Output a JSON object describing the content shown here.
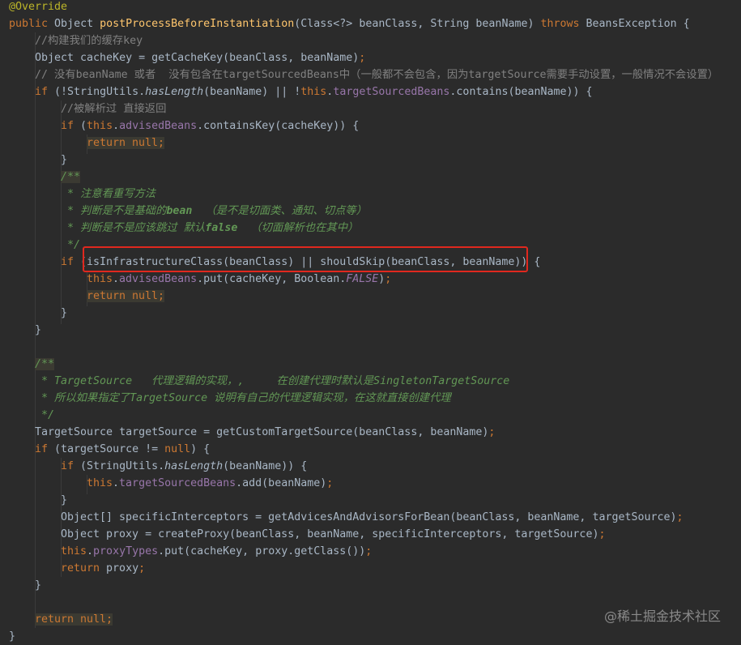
{
  "lines": [
    {
      "indent": 0,
      "tokens": [
        [
          "ann",
          "@Override"
        ]
      ]
    },
    {
      "indent": 0,
      "tokens": [
        [
          "kw",
          "public "
        ],
        [
          "t",
          "Object "
        ],
        [
          "fn",
          "postProcessBeforeInstantiation"
        ],
        [
          "t",
          "(Class<?> beanClass, String beanName) "
        ],
        [
          "kw",
          "throws "
        ],
        [
          "t",
          "BeansException {"
        ]
      ]
    },
    {
      "indent": 1,
      "tokens": [
        [
          "cm",
          "//构建我们的缓存key"
        ]
      ]
    },
    {
      "indent": 1,
      "tokens": [
        [
          "t",
          "Object cacheKey = getCacheKey(beanClass, beanName)"
        ],
        [
          "kw",
          ";"
        ]
      ]
    },
    {
      "indent": 1,
      "tokens": [
        [
          "cm",
          "// 没有beanName 或者  没有包含在targetSourcedBeans中（一般都不会包含，因为targetSource需要手动设置，一般情况不会设置）"
        ]
      ]
    },
    {
      "indent": 1,
      "tokens": [
        [
          "kw",
          "if "
        ],
        [
          "t",
          "(!StringUtils."
        ],
        [
          "itc",
          "hasLength"
        ],
        [
          "t",
          "(beanName) || !"
        ],
        [
          "kw",
          "this"
        ],
        [
          "t",
          "."
        ],
        [
          "fld",
          "targetSourcedBeans"
        ],
        [
          "t",
          ".contains(beanName)) {"
        ]
      ]
    },
    {
      "indent": 2,
      "tokens": [
        [
          "cm",
          "//被解析过 直接返回"
        ]
      ]
    },
    {
      "indent": 2,
      "tokens": [
        [
          "kw",
          "if "
        ],
        [
          "t",
          "("
        ],
        [
          "kw",
          "this"
        ],
        [
          "t",
          "."
        ],
        [
          "fld",
          "advisedBeans"
        ],
        [
          "t",
          ".containsKey(cacheKey)) {"
        ]
      ]
    },
    {
      "indent": 3,
      "tokens": [
        [
          "kwhl",
          "return null;"
        ]
      ]
    },
    {
      "indent": 2,
      "tokens": [
        [
          "t",
          "}"
        ]
      ]
    },
    {
      "indent": 2,
      "tokens": [
        [
          "dochl",
          "/**"
        ]
      ]
    },
    {
      "indent": 2,
      "tokens": [
        [
          "doc",
          " * 注意看重写方法"
        ]
      ]
    },
    {
      "indent": 2,
      "tokens": [
        [
          "doc",
          " * 判断是不是基础的"
        ],
        [
          "dtag",
          "bean"
        ],
        [
          "doc",
          "  （是不是切面类、通知、切点等）"
        ]
      ]
    },
    {
      "indent": 2,
      "tokens": [
        [
          "doc",
          " * 判断是不是应该跳过 默认"
        ],
        [
          "dtag",
          "false"
        ],
        [
          "doc",
          "  （切面解析也在其中）"
        ]
      ]
    },
    {
      "indent": 2,
      "tokens": [
        [
          "doc",
          " */"
        ]
      ]
    },
    {
      "indent": 2,
      "tokens": [
        [
          "kw",
          "if "
        ],
        [
          "t",
          "(isInfrastructureClass(beanClass) || shouldSkip(beanClass, beanName)) {"
        ]
      ]
    },
    {
      "indent": 3,
      "tokens": [
        [
          "kw",
          "this"
        ],
        [
          "t",
          "."
        ],
        [
          "fld",
          "advisedBeans"
        ],
        [
          "t",
          ".put(cacheKey, Boolean."
        ],
        [
          "fldi",
          "FALSE"
        ],
        [
          "t",
          ")"
        ],
        [
          "kw",
          ";"
        ]
      ]
    },
    {
      "indent": 3,
      "tokens": [
        [
          "kwhl",
          "return null;"
        ]
      ]
    },
    {
      "indent": 2,
      "tokens": [
        [
          "t",
          "}"
        ]
      ]
    },
    {
      "indent": 1,
      "tokens": [
        [
          "t",
          "}"
        ]
      ]
    },
    {
      "indent": 0,
      "tokens": []
    },
    {
      "indent": 1,
      "tokens": [
        [
          "dochl",
          "/**"
        ]
      ]
    },
    {
      "indent": 1,
      "tokens": [
        [
          "doc",
          " * TargetSource   代理逻辑的实现，,     在创建代理时默认是SingletonTargetSource"
        ]
      ]
    },
    {
      "indent": 1,
      "tokens": [
        [
          "doc",
          " * 所以如果指定了TargetSource 说明有自己的代理逻辑实现，在这就直接创建代理"
        ]
      ]
    },
    {
      "indent": 1,
      "tokens": [
        [
          "doc",
          " */"
        ]
      ]
    },
    {
      "indent": 1,
      "tokens": [
        [
          "t",
          "TargetSource targetSource = getCustomTargetSource(beanClass, beanName)"
        ],
        [
          "kw",
          ";"
        ]
      ]
    },
    {
      "indent": 1,
      "tokens": [
        [
          "kw",
          "if "
        ],
        [
          "t",
          "(targetSource != "
        ],
        [
          "kw",
          "null"
        ],
        [
          "t",
          ") {"
        ]
      ]
    },
    {
      "indent": 2,
      "tokens": [
        [
          "kw",
          "if "
        ],
        [
          "t",
          "(StringUtils."
        ],
        [
          "itc",
          "hasLength"
        ],
        [
          "t",
          "(beanName)) {"
        ]
      ]
    },
    {
      "indent": 3,
      "tokens": [
        [
          "kw",
          "this"
        ],
        [
          "t",
          "."
        ],
        [
          "fld",
          "targetSourcedBeans"
        ],
        [
          "t",
          ".add(beanName)"
        ],
        [
          "kw",
          ";"
        ]
      ]
    },
    {
      "indent": 2,
      "tokens": [
        [
          "t",
          "}"
        ]
      ]
    },
    {
      "indent": 2,
      "tokens": [
        [
          "t",
          "Object[] specificInterceptors = getAdvicesAndAdvisorsForBean(beanClass, beanName, targetSource)"
        ],
        [
          "kw",
          ";"
        ]
      ]
    },
    {
      "indent": 2,
      "tokens": [
        [
          "t",
          "Object proxy = createProxy(beanClass, beanName, specificInterceptors, targetSource)"
        ],
        [
          "kw",
          ";"
        ]
      ]
    },
    {
      "indent": 2,
      "tokens": [
        [
          "kw",
          "this"
        ],
        [
          "t",
          "."
        ],
        [
          "fld",
          "proxyTypes"
        ],
        [
          "t",
          ".put(cacheKey, proxy.getClass())"
        ],
        [
          "kw",
          ";"
        ]
      ]
    },
    {
      "indent": 2,
      "tokens": [
        [
          "kw",
          "return "
        ],
        [
          "t",
          "proxy"
        ],
        [
          "kw",
          ";"
        ]
      ]
    },
    {
      "indent": 1,
      "tokens": [
        [
          "t",
          "}"
        ]
      ]
    },
    {
      "indent": 0,
      "tokens": []
    },
    {
      "indent": 1,
      "tokens": [
        [
          "kwhl",
          "return null;"
        ]
      ]
    },
    {
      "indent": 0,
      "tokens": [
        [
          "t",
          "}"
        ]
      ]
    }
  ],
  "watermark": "@稀土掘金技术社区",
  "colors": {
    "background": "#2b2b2b",
    "keyword": "#cc7832",
    "method": "#ffc66d",
    "field": "#9876aa",
    "comment": "#808080",
    "doc": "#629755",
    "annotation": "#bbb529",
    "highlight_box": "#e0281e"
  }
}
